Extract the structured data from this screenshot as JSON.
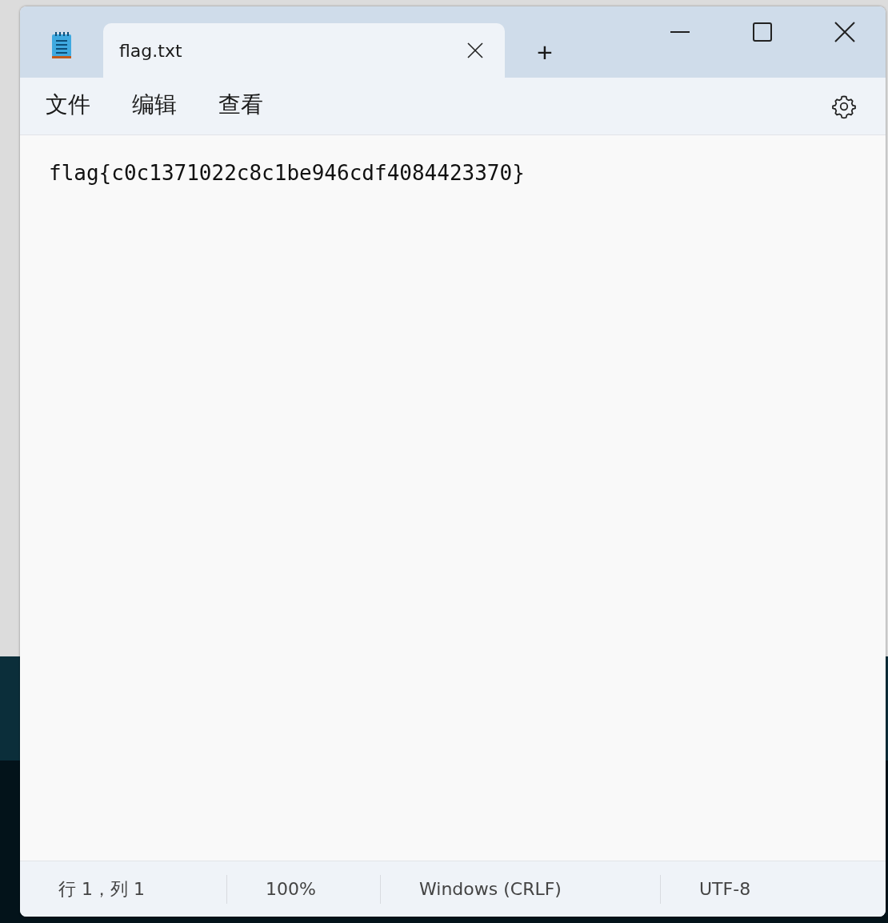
{
  "tabs": [
    {
      "label": "flag.txt",
      "selected": true
    }
  ],
  "new_tab": "+",
  "menu": [
    "文件",
    "编辑",
    "查看"
  ],
  "editor": {
    "text": "flag{c0c1371022c8c1be946cdf4084423370}"
  },
  "status_bar": [
    "行 1，列 1",
    "100%",
    "Windows (CRLF)",
    "UTF-8"
  ]
}
